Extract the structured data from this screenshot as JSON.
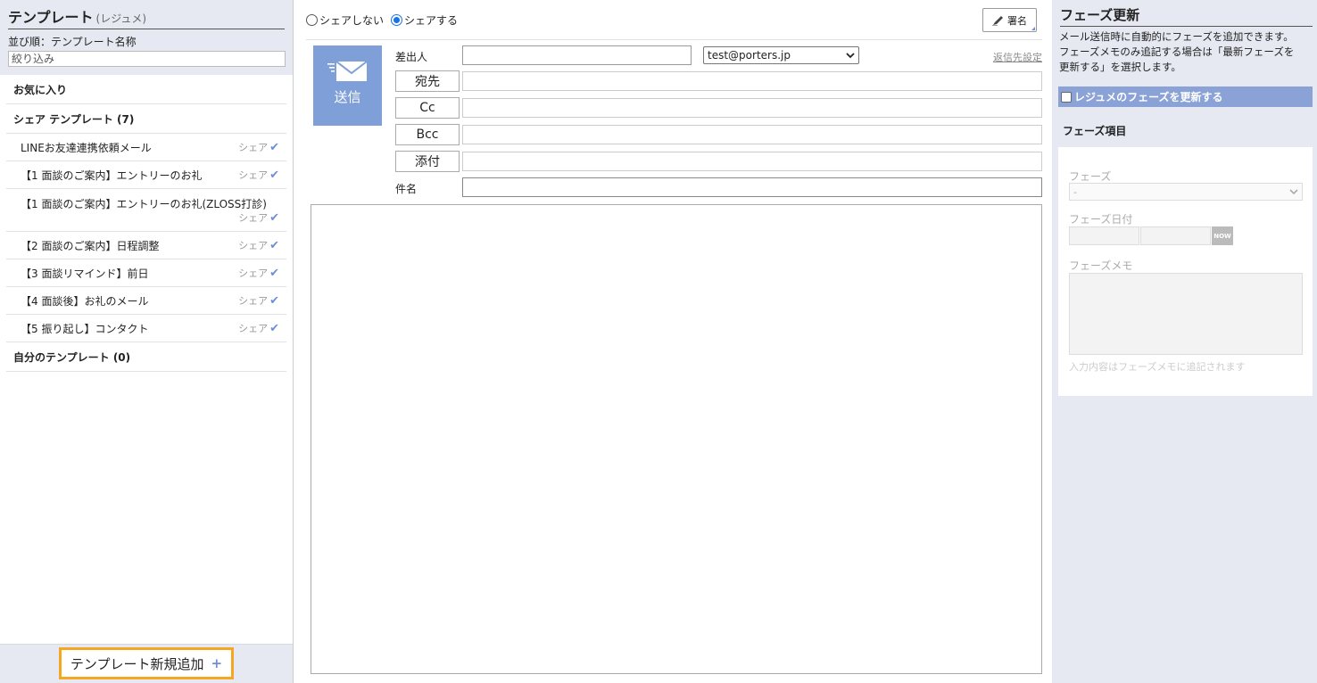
{
  "left": {
    "title": "テンプレート",
    "title_sub": "(レジュメ)",
    "sort_label": "並び順：テンプレート名称",
    "filter_placeholder": "絞り込み",
    "favorites": "お気に入り",
    "shared_header": "シェア テンプレート (7)",
    "share_label": "シェア",
    "items": [
      {
        "name": "LINEお友達連携依頼メール"
      },
      {
        "name": "【1 面談のご案内】エントリーのお礼"
      },
      {
        "name": "【1 面談のご案内】エントリーのお礼(ZLOSS打診)"
      },
      {
        "name": "【2 面談のご案内】日程調整"
      },
      {
        "name": "【3 面談リマインド】前日"
      },
      {
        "name": "【4 面談後】お礼のメール"
      },
      {
        "name": "【5 振り起し】コンタクト"
      }
    ],
    "own_header": "自分のテンプレート (0)",
    "add_button": "テンプレート新規追加",
    "add_plus": "+"
  },
  "center": {
    "radio_no_share": "シェアしない",
    "radio_share": "シェアする",
    "radio_selected": "share",
    "signature": "署名",
    "send": "送信",
    "from_label": "差出人",
    "from_email": "test@porters.jp",
    "reply_to": "返信先設定",
    "to": "宛先",
    "cc": "Cc",
    "bcc": "Bcc",
    "attach": "添付",
    "subject": "件名"
  },
  "right": {
    "title": "フェーズ更新",
    "desc_line1": "メール送信時に自動的にフェーズを追加できます。",
    "desc_line2": "フェーズメモのみ追記する場合は「最新フェーズを",
    "desc_line3": "更新する」を選択します。",
    "update_check": "レジュメのフェーズを更新する",
    "items_label": "フェーズ項目",
    "phase_label": "フェーズ",
    "phase_value": "-",
    "phase_date_label": "フェーズ日付",
    "now": "NOW",
    "phase_memo_label": "フェーズメモ",
    "memo_note": "入力内容はフェーズメモに追記されます"
  },
  "colors": {
    "panel_bg": "#e6e9f2",
    "accent": "#7f9fd9",
    "highlight": "#f5a623"
  }
}
